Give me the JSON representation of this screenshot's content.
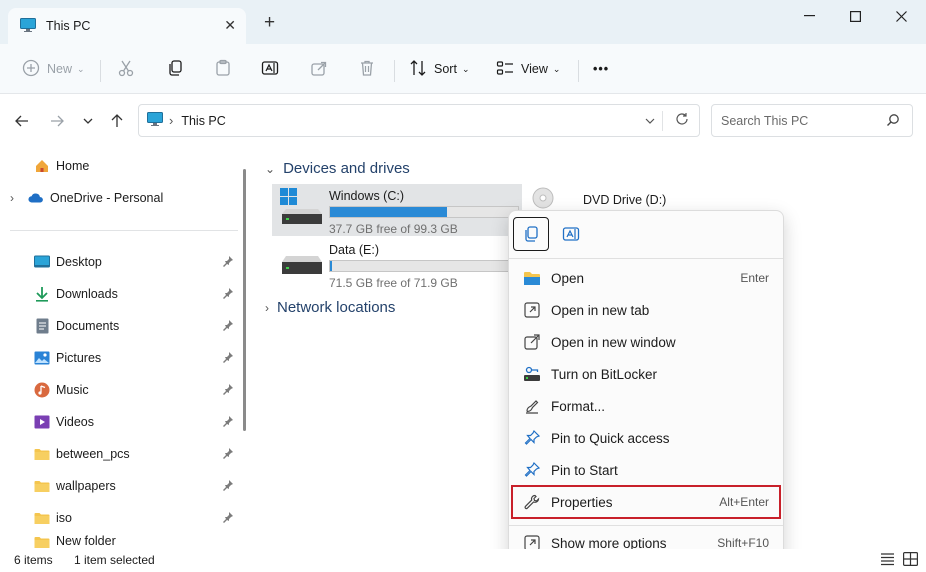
{
  "window": {
    "tab_title": "This PC",
    "new_tab": "+",
    "close_tab": "✕",
    "minimize": "—",
    "maximize": "☐",
    "close": "✕"
  },
  "toolbar": {
    "new_label": "New",
    "sort_label": "Sort",
    "view_label": "View",
    "more_label": "•••"
  },
  "address": {
    "location": "This PC",
    "search_placeholder": "Search This PC"
  },
  "sidebar": {
    "items": [
      {
        "label": "Home"
      },
      {
        "label": "OneDrive - Personal"
      },
      {
        "label": "Desktop"
      },
      {
        "label": "Downloads"
      },
      {
        "label": "Documents"
      },
      {
        "label": "Pictures"
      },
      {
        "label": "Music"
      },
      {
        "label": "Videos"
      },
      {
        "label": "between_pcs"
      },
      {
        "label": "wallpapers"
      },
      {
        "label": "iso"
      },
      {
        "label": "New folder"
      }
    ]
  },
  "main": {
    "section_devices": "Devices and drives",
    "section_network": "Network locations",
    "drives": [
      {
        "name": "Windows (C:)",
        "free": "37.7 GB free of 99.3 GB",
        "used_fraction": 0.62
      },
      {
        "name": "Data (E:)",
        "free": "71.5 GB free of 71.9 GB",
        "used_fraction": 0.005
      },
      {
        "name": "DVD Drive (D:)"
      }
    ]
  },
  "context_menu": {
    "items": [
      {
        "label": "Open",
        "shortcut": "Enter"
      },
      {
        "label": "Open in new tab",
        "shortcut": ""
      },
      {
        "label": "Open in new window",
        "shortcut": ""
      },
      {
        "label": "Turn on BitLocker",
        "shortcut": ""
      },
      {
        "label": "Format...",
        "shortcut": ""
      },
      {
        "label": "Pin to Quick access",
        "shortcut": ""
      },
      {
        "label": "Pin to Start",
        "shortcut": ""
      },
      {
        "label": "Properties",
        "shortcut": "Alt+Enter"
      },
      {
        "label": "Show more options",
        "shortcut": "Shift+F10"
      }
    ]
  },
  "status": {
    "item_count": "6 items",
    "selection": "1 item selected"
  },
  "colors": {
    "accent": "#2a8ad6",
    "highlight_border": "#c8202a"
  }
}
